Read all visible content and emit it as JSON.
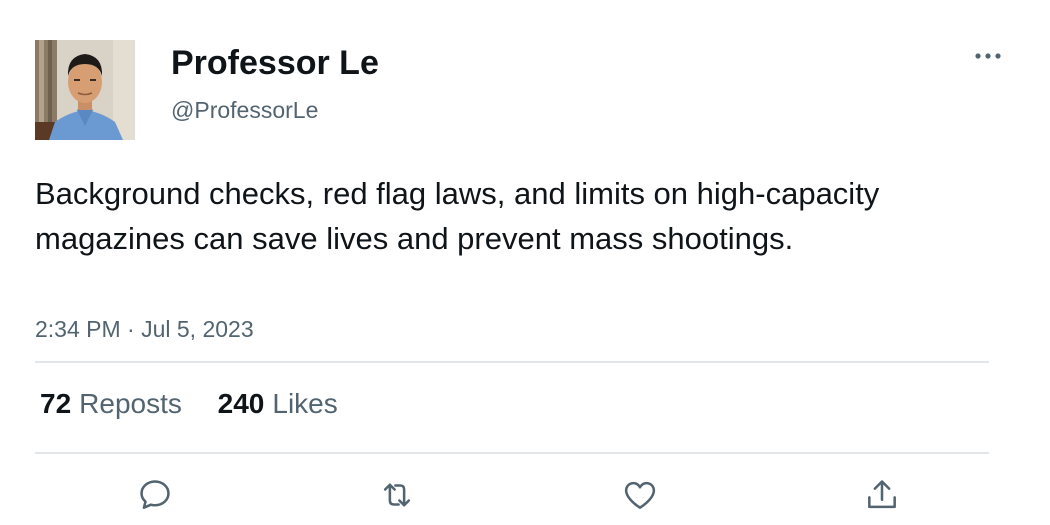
{
  "author": {
    "display_name": "Professor Le",
    "handle": "@ProfessorLe"
  },
  "tweet": {
    "text": "Background checks, red flag laws, and limits on high-capacity magazines can save lives and prevent mass shootings.",
    "timestamp": "2:34 PM · Jul 5, 2023"
  },
  "stats": {
    "reposts_count": "72",
    "reposts_label": "Reposts",
    "likes_count": "240",
    "likes_label": "Likes"
  },
  "actions": {
    "reply_icon": "speech-bubble-icon",
    "repost_icon": "repost-arrows-icon",
    "like_icon": "heart-icon",
    "share_icon": "share-upload-icon"
  },
  "colors": {
    "primary_text": "#0f1419",
    "secondary_text": "#536471",
    "divider": "#e3e6e8"
  }
}
